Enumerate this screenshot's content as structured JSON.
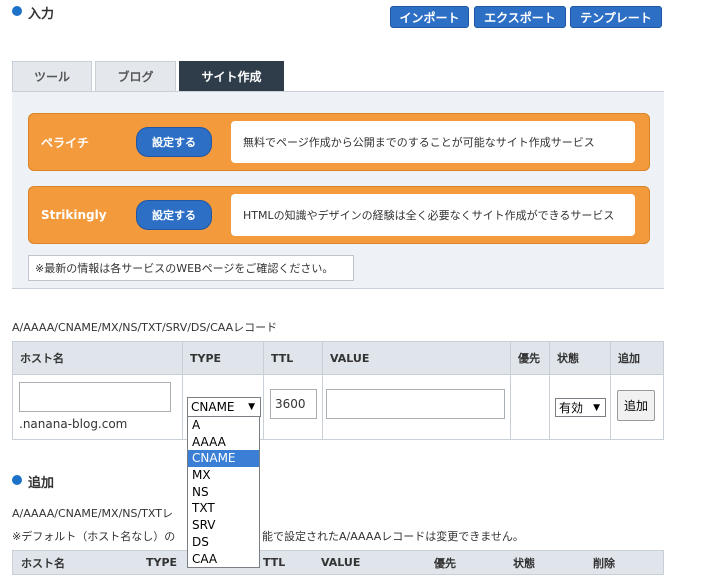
{
  "header": {
    "title": "入力",
    "buttons": [
      {
        "label": "インポート"
      },
      {
        "label": "エクスポート"
      },
      {
        "label": "テンプレート"
      }
    ]
  },
  "tabs": [
    {
      "label": "ツール",
      "active": false
    },
    {
      "label": "ブログ",
      "active": false
    },
    {
      "label": "サイト作成",
      "active": true
    }
  ],
  "services": [
    {
      "name": "ペライチ",
      "button": "設定する",
      "description": "無料でページ作成から公開までのすることが可能なサイト作成サービス"
    },
    {
      "name": "Strikingly",
      "button": "設定する",
      "description": "HTMLの知識やデザインの経験は全く必要なくサイト作成ができるサービス"
    }
  ],
  "note": "※最新の情報は各サービスのWEBページをご確認ください。",
  "record_form": {
    "caption": "A/AAAA/CNAME/MX/NS/TXT/SRV/DS/CAAレコード",
    "headers": {
      "host": "ホスト名",
      "type": "TYPE",
      "ttl": "TTL",
      "value": "VALUE",
      "priority": "優先",
      "status": "状態",
      "add": "追加"
    },
    "host_value": "",
    "domain_suffix": ".nanana-blog.com",
    "type_selected": "CNAME",
    "ttl_value": "3600",
    "value_value": "",
    "status_selected": "有効",
    "add_button": "追加"
  },
  "type_options": [
    "A",
    "AAAA",
    "CNAME",
    "MX",
    "NS",
    "TXT",
    "SRV",
    "DS",
    "CAA"
  ],
  "add_section": {
    "title": "追加",
    "caption_prefix": "A/AAAA/CNAME/MX/NS/TXTレ",
    "warning_left": "※デフォルト（ホスト名なし）の",
    "warning_right": "能で設定されたA/AAAAレコードは変更できません。",
    "headers": {
      "host": "ホスト名",
      "type": "TYPE",
      "ttl": "TTL",
      "value": "VALUE",
      "priority": "優先",
      "status": "状態",
      "delete": "削除"
    }
  },
  "colors": {
    "accent_blue": "#2d6fc5",
    "service_orange": "#f39a3d",
    "tab_active": "#2f3d4a",
    "selected_option": "#3a7fd5"
  }
}
